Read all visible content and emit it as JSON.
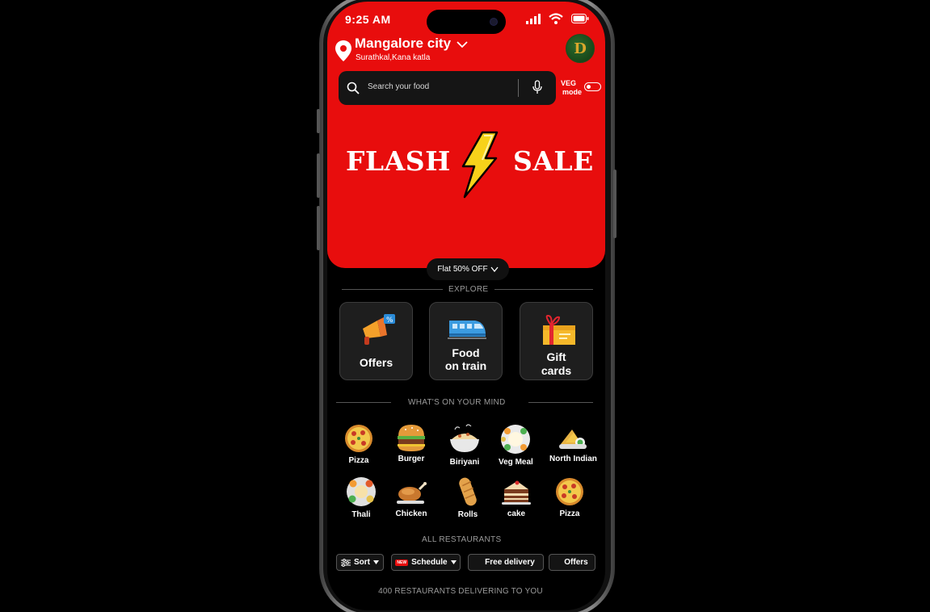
{
  "status_bar": {
    "time": "9:25 AM"
  },
  "location": {
    "city": "Mangalore city",
    "area": "Surathkal,Kana katla"
  },
  "avatar": {
    "initial": "D"
  },
  "search": {
    "placeholder": "Search your food"
  },
  "veg_mode": {
    "label_line1": "VEG",
    "label_line2": "mode",
    "enabled": false
  },
  "banner": {
    "left_word": "FLASH",
    "right_word": "SALE"
  },
  "offer_pill": {
    "label": "Flat 50% OFF"
  },
  "explore": {
    "title": "EXPLORE",
    "cards": [
      {
        "label": "Offers",
        "icon": "megaphone-icon"
      },
      {
        "label_line1": "Food",
        "label_line2": "on train",
        "icon": "train-icon"
      },
      {
        "label_line1": "Gift",
        "label_line2": "cards",
        "icon": "gift-icon"
      }
    ]
  },
  "mind": {
    "title": "WHAT'S ON YOUR MIND",
    "row1": [
      "Pizza",
      "Burger",
      "Biriyani",
      "Veg Meal",
      "North Indian"
    ],
    "row2": [
      "Thali",
      "Chicken",
      "Rolls",
      "cake",
      "Pizza"
    ]
  },
  "restaurants": {
    "title": "ALL RESTAURANTS",
    "filters": {
      "sort": "Sort",
      "schedule": "Schedule",
      "schedule_badge": "NEW",
      "free_delivery": "Free delivery",
      "offers": "Offers"
    },
    "footer": "400 RESTAURANTS DELIVERING TO YOU"
  },
  "colors": {
    "brand_red": "#e80d0d",
    "background": "#000000",
    "card": "#1e1e1e"
  }
}
